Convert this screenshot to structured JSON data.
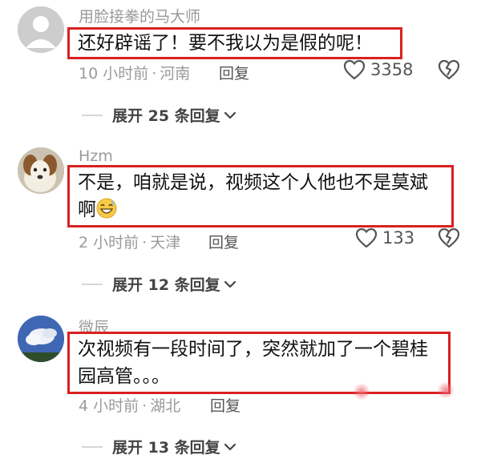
{
  "comments": [
    {
      "username": "用脸接拳的马大师",
      "text": "还好辟谣了！要不我以为是假的呢！",
      "time": "10 小时前",
      "location": "河南",
      "reply_label": "回复",
      "likes": "3358",
      "expand": "展开 25 条回复",
      "avatar": "gray-placeholder-avatar"
    },
    {
      "username": "Hzm",
      "text_line1": "不是，咱就是说，视频这个人他也不是莫斌",
      "text_line2": "啊",
      "emoji": "grinning-sweat-emoji",
      "time": "2 小时前",
      "location": "天津",
      "reply_label": "回复",
      "likes": "133",
      "expand": "展开 12 条回复",
      "avatar": "dog-avatar"
    },
    {
      "username": "微辰",
      "text_line1": "次视频有一段时间了，突然就加了一个碧桂",
      "text_line2": "园高管。。。",
      "time": "4 小时前",
      "location": "湖北",
      "reply_label": "回复",
      "expand": "展开 13 条回复",
      "avatar": "sky-clouds-avatar"
    }
  ],
  "colors": {
    "highlight_border": "#d92020",
    "meta_text": "#9a9a9a",
    "body_text": "#111111"
  },
  "icons": {
    "like": "heart-outline-icon",
    "dislike": "broken-heart-icon",
    "expand": "chevron-down-icon"
  }
}
